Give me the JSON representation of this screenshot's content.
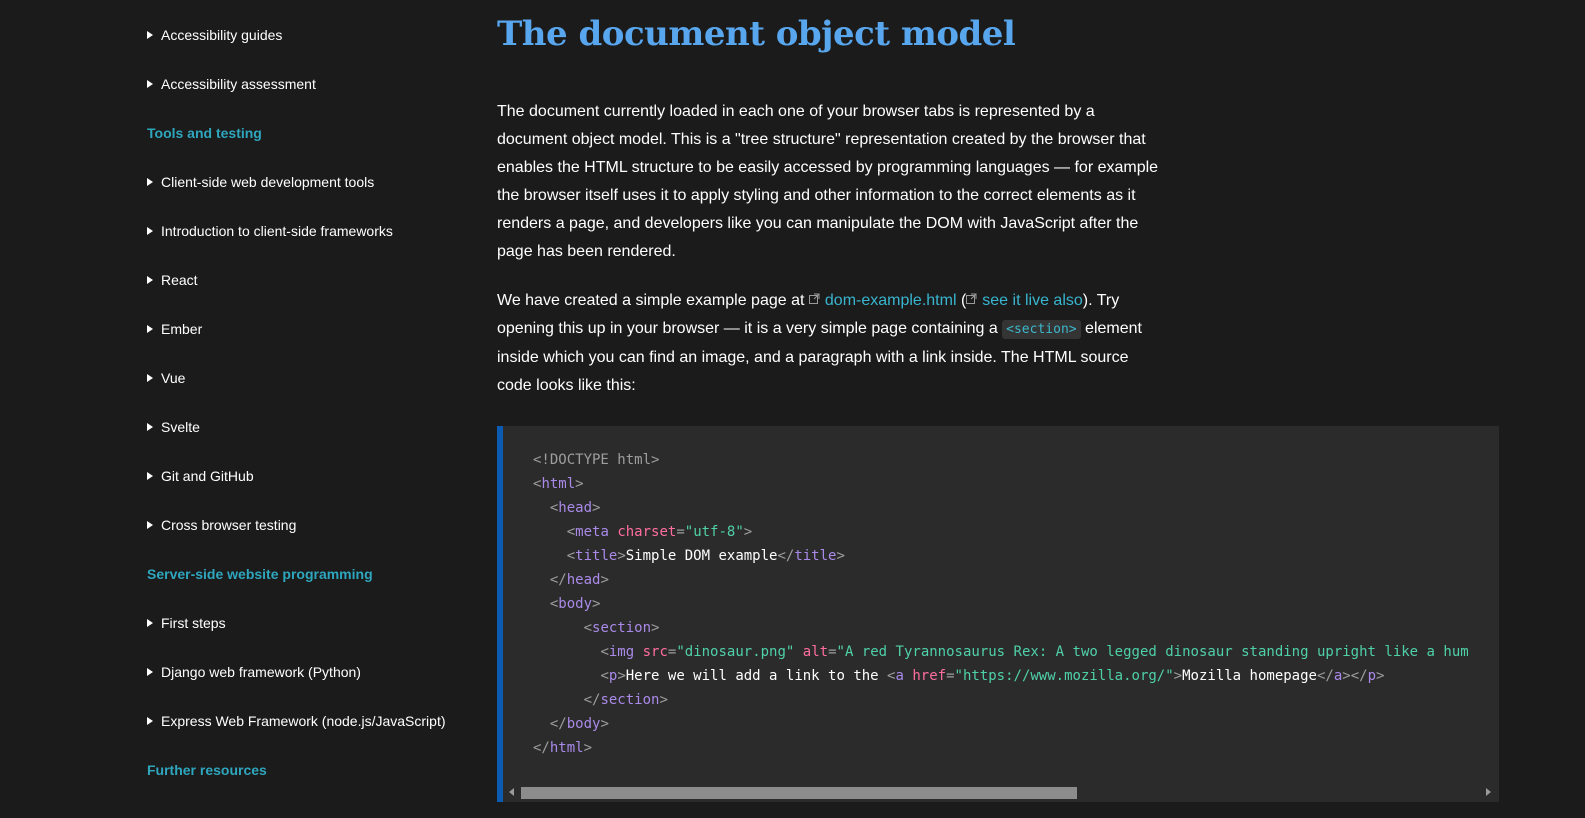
{
  "sidebar": {
    "items": [
      {
        "type": "item",
        "label": "Accessibility guides"
      },
      {
        "type": "item",
        "label": "Accessibility assessment"
      },
      {
        "type": "section",
        "label": "Tools and testing"
      },
      {
        "type": "item",
        "label": "Client-side web development tools"
      },
      {
        "type": "item",
        "label": "Introduction to client-side frameworks"
      },
      {
        "type": "item",
        "label": "React"
      },
      {
        "type": "item",
        "label": "Ember"
      },
      {
        "type": "item",
        "label": "Vue"
      },
      {
        "type": "item",
        "label": "Svelte"
      },
      {
        "type": "item",
        "label": "Git and GitHub"
      },
      {
        "type": "item",
        "label": "Cross browser testing"
      },
      {
        "type": "section",
        "label": "Server-side website programming"
      },
      {
        "type": "item",
        "label": "First steps"
      },
      {
        "type": "item",
        "label": "Django web framework (Python)"
      },
      {
        "type": "item",
        "label": "Express Web Framework (node.js/JavaScript)"
      },
      {
        "type": "section",
        "label": "Further resources"
      }
    ]
  },
  "main": {
    "title": "The document object model",
    "para1": "The document currently loaded in each one of your browser tabs is represented by a document object model. This is a \"tree structure\" representation created by the browser that enables the HTML structure to be easily accessed by programming languages — for example the browser itself uses it to apply styling and other information to the correct elements as it renders a page, and developers like you can manipulate the DOM with JavaScript after the page has been rendered.",
    "para2": {
      "t1": "We have created a simple example page at ",
      "link1": "dom-example.html",
      "t2": " (",
      "link2": "see it live also",
      "t3": "). Try opening this up in your browser — it is a very simple page containing a ",
      "code": "<section>",
      "t4": " element inside which you can find an image, and a paragraph with a link inside. The HTML source code looks like this:"
    },
    "code_lines": [
      {
        "indent": "",
        "parts": [
          [
            "punc",
            "<!"
          ],
          [
            "dt",
            "DOCTYPE html"
          ],
          [
            "punc",
            ">"
          ]
        ]
      },
      {
        "indent": "",
        "parts": [
          [
            "punc",
            "<"
          ],
          [
            "tag",
            "html"
          ],
          [
            "punc",
            ">"
          ]
        ]
      },
      {
        "indent": "  ",
        "parts": [
          [
            "punc",
            "<"
          ],
          [
            "tag",
            "head"
          ],
          [
            "punc",
            ">"
          ]
        ]
      },
      {
        "indent": "    ",
        "parts": [
          [
            "punc",
            "<"
          ],
          [
            "tag",
            "meta"
          ],
          [
            "text",
            " "
          ],
          [
            "attr",
            "charset"
          ],
          [
            "punc",
            "="
          ],
          [
            "val",
            "\"utf-8\""
          ],
          [
            "punc",
            ">"
          ]
        ]
      },
      {
        "indent": "    ",
        "parts": [
          [
            "punc",
            "<"
          ],
          [
            "tag",
            "title"
          ],
          [
            "punc",
            ">"
          ],
          [
            "text",
            "Simple DOM example"
          ],
          [
            "punc",
            "</"
          ],
          [
            "tag",
            "title"
          ],
          [
            "punc",
            ">"
          ]
        ]
      },
      {
        "indent": "  ",
        "parts": [
          [
            "punc",
            "</"
          ],
          [
            "tag",
            "head"
          ],
          [
            "punc",
            ">"
          ]
        ]
      },
      {
        "indent": "  ",
        "parts": [
          [
            "punc",
            "<"
          ],
          [
            "tag",
            "body"
          ],
          [
            "punc",
            ">"
          ]
        ]
      },
      {
        "indent": "      ",
        "parts": [
          [
            "punc",
            "<"
          ],
          [
            "tag",
            "section"
          ],
          [
            "punc",
            ">"
          ]
        ]
      },
      {
        "indent": "        ",
        "parts": [
          [
            "punc",
            "<"
          ],
          [
            "tag",
            "img"
          ],
          [
            "text",
            " "
          ],
          [
            "attr",
            "src"
          ],
          [
            "punc",
            "="
          ],
          [
            "val",
            "\"dinosaur.png\""
          ],
          [
            "text",
            " "
          ],
          [
            "attr",
            "alt"
          ],
          [
            "punc",
            "="
          ],
          [
            "val",
            "\"A red Tyrannosaurus Rex: A two legged dinosaur standing upright like a hum"
          ]
        ]
      },
      {
        "indent": "        ",
        "parts": [
          [
            "punc",
            "<"
          ],
          [
            "tag",
            "p"
          ],
          [
            "punc",
            ">"
          ],
          [
            "text",
            "Here we will add a link to the "
          ],
          [
            "punc",
            "<"
          ],
          [
            "tag",
            "a"
          ],
          [
            "text",
            " "
          ],
          [
            "attr",
            "href"
          ],
          [
            "punc",
            "="
          ],
          [
            "val",
            "\"https://www.mozilla.org/\""
          ],
          [
            "punc",
            ">"
          ],
          [
            "text",
            "Mozilla homepage"
          ],
          [
            "punc",
            "</"
          ],
          [
            "tag",
            "a"
          ],
          [
            "punc",
            "></"
          ],
          [
            "tag",
            "p"
          ],
          [
            "punc",
            ">"
          ]
        ]
      },
      {
        "indent": "      ",
        "parts": [
          [
            "punc",
            "</"
          ],
          [
            "tag",
            "section"
          ],
          [
            "punc",
            ">"
          ]
        ]
      },
      {
        "indent": "  ",
        "parts": [
          [
            "punc",
            "</"
          ],
          [
            "tag",
            "body"
          ],
          [
            "punc",
            ">"
          ]
        ]
      },
      {
        "indent": "",
        "parts": [
          [
            "punc",
            "</"
          ],
          [
            "tag",
            "html"
          ],
          [
            "punc",
            ">"
          ]
        ]
      }
    ]
  },
  "colors": {
    "background": "#1b1b1b",
    "title": "#58a6ee",
    "section_heading": "#2ea6bd",
    "link": "#38b5cf",
    "code_bg": "#2b2b2b",
    "code_border": "#0a5bb1"
  },
  "icons": {
    "nav_expander": "triangle-right-icon",
    "external_link": "external-link-icon"
  }
}
